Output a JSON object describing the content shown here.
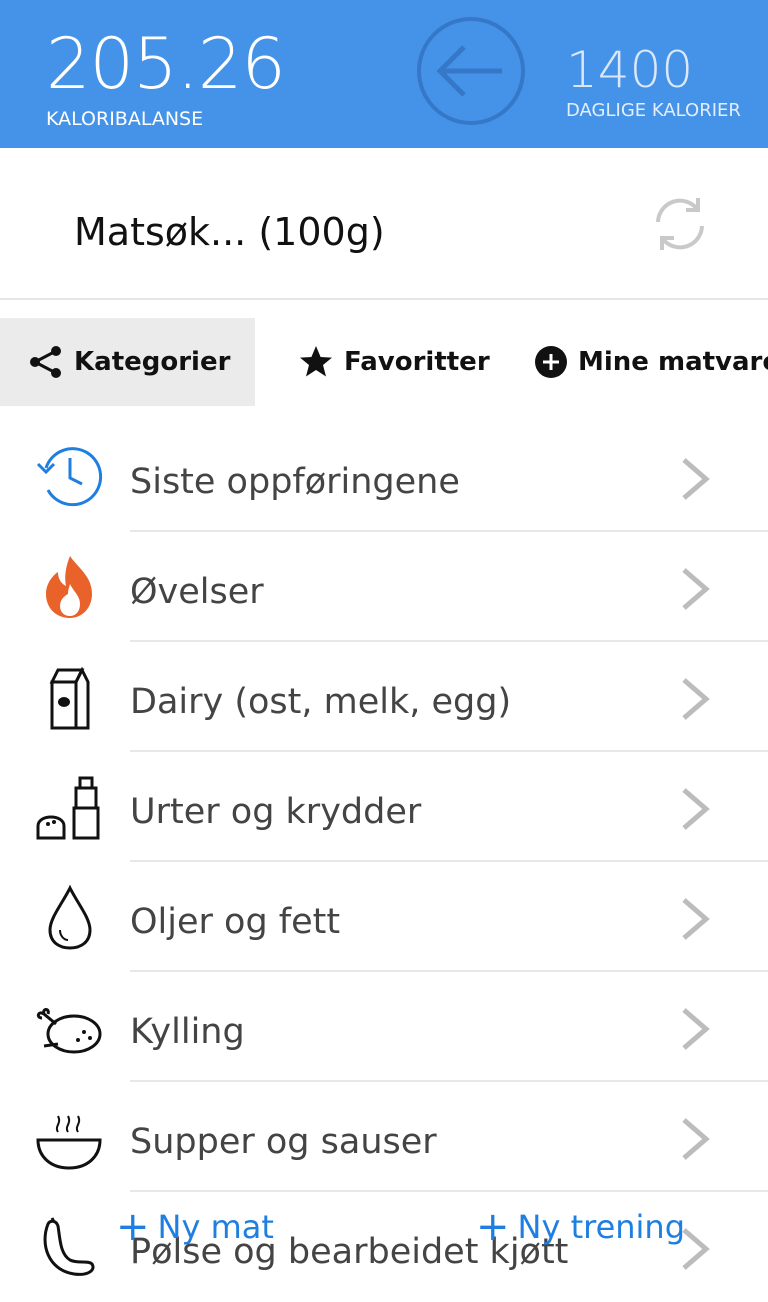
{
  "header": {
    "balance_value": "205.26",
    "balance_label": "KALORIBALANSE",
    "daily_value": "1400",
    "daily_label": "DAGLIGE KALORIER",
    "color": "#4593e8"
  },
  "search": {
    "text": "Matsøk... (100g)"
  },
  "tabs": [
    {
      "label": "Kategorier",
      "icon": "share-icon",
      "active": true
    },
    {
      "label": "Favoritter",
      "icon": "star-icon",
      "active": false
    },
    {
      "label": "Mine matvare",
      "icon": "plus-circle-icon",
      "active": false
    }
  ],
  "categories": [
    {
      "label": "Siste oppføringene",
      "icon": "history-clock-icon"
    },
    {
      "label": "Øvelser",
      "icon": "flame-icon"
    },
    {
      "label": "Dairy (ost, melk, egg)",
      "icon": "milk-carton-icon"
    },
    {
      "label": "Urter og krydder",
      "icon": "salt-pepper-icon"
    },
    {
      "label": "Oljer og fett",
      "icon": "oil-drop-icon"
    },
    {
      "label": "Kylling",
      "icon": "roast-chicken-icon"
    },
    {
      "label": "Supper og sauser",
      "icon": "soup-bowl-icon"
    },
    {
      "label": "Pølse og bearbeidet kjøtt",
      "icon": "sausage-icon"
    }
  ],
  "bottom_bar": {
    "new_food": "Ny mat",
    "new_workout": "Ny trening",
    "accent": "#1f7fe0"
  }
}
